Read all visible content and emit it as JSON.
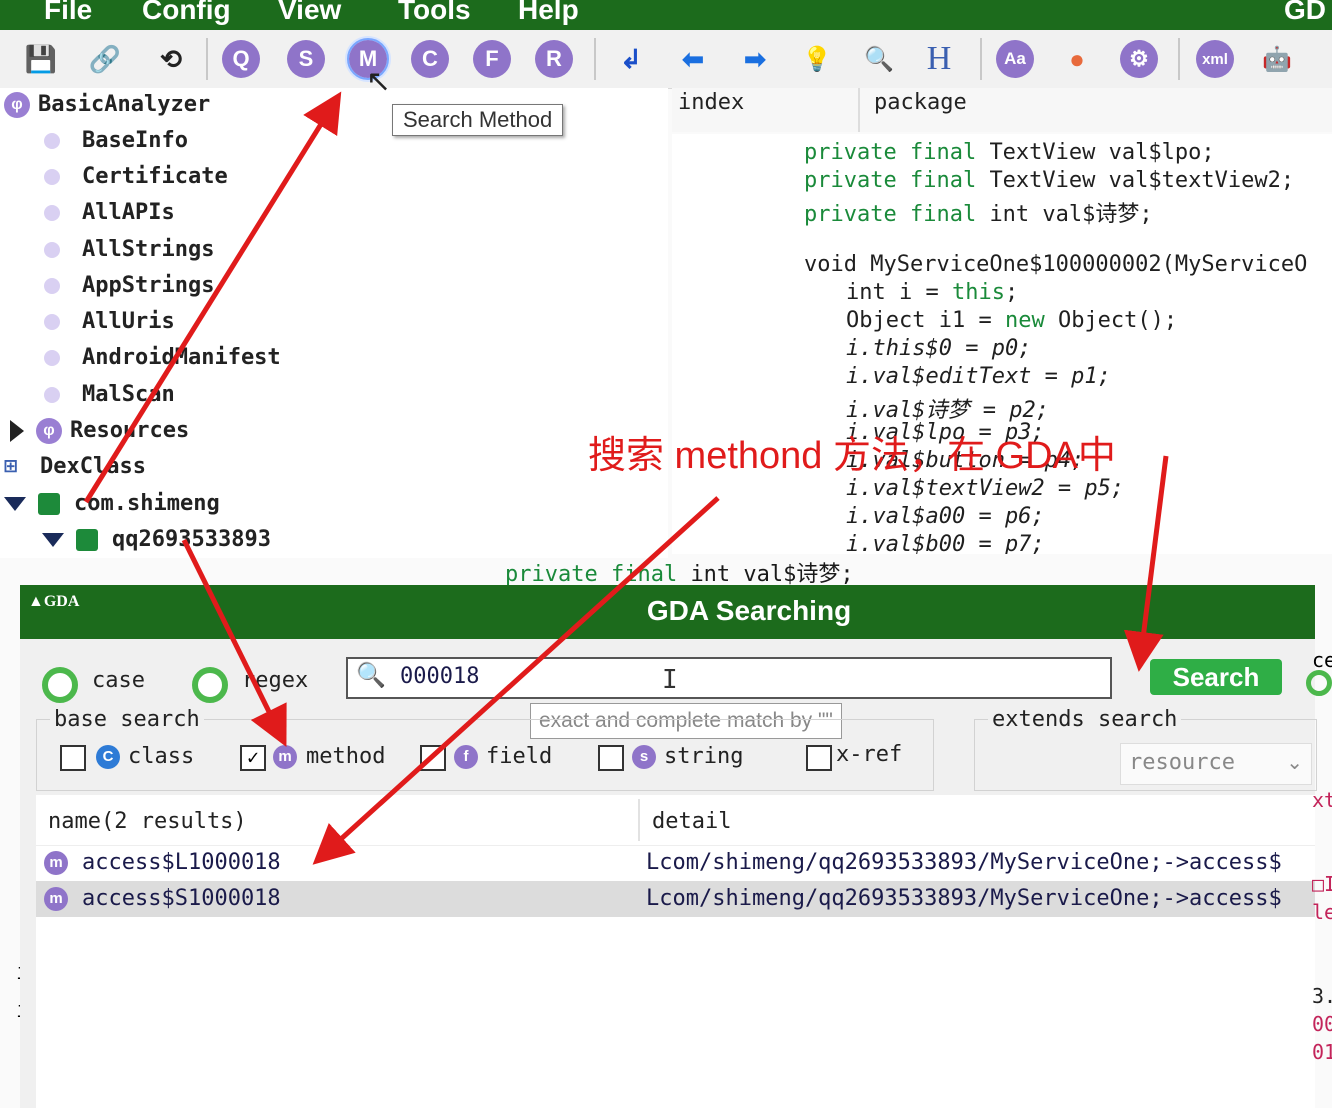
{
  "menubar": {
    "items": [
      "File",
      "Config",
      "View",
      "Tools",
      "Help"
    ],
    "app_label": "GD"
  },
  "toolbar": {
    "search_method_tooltip": "Search Method",
    "buttons": [
      {
        "name": "save-icon",
        "label": "💾"
      },
      {
        "name": "link-icon",
        "label": "🔗"
      },
      {
        "name": "user-refresh-icon",
        "label": "⟲"
      },
      {
        "name": "search-q-icon",
        "label": "Q"
      },
      {
        "name": "search-string-icon",
        "label": "S"
      },
      {
        "name": "search-method-icon",
        "label": "M"
      },
      {
        "name": "search-class-icon",
        "label": "C"
      },
      {
        "name": "search-field-icon",
        "label": "F"
      },
      {
        "name": "search-resource-icon",
        "label": "R"
      },
      {
        "name": "jump-icon",
        "label": "↲"
      },
      {
        "name": "back-icon",
        "label": "⬅"
      },
      {
        "name": "forward-icon",
        "label": "➡"
      },
      {
        "name": "bulb-icon",
        "label": "💡"
      },
      {
        "name": "report-icon",
        "label": "🔍"
      },
      {
        "name": "hex-icon",
        "label": "H"
      },
      {
        "name": "font-icon",
        "label": "Aa"
      },
      {
        "name": "palette-icon",
        "label": "●"
      },
      {
        "name": "settings-icon",
        "label": "⚙"
      },
      {
        "name": "xml-icon",
        "label": "xml"
      },
      {
        "name": "android-icon",
        "label": "🤖"
      }
    ]
  },
  "tree": {
    "root": "BasicAnalyzer",
    "children": [
      "BaseInfo",
      "Certificate",
      "AllAPIs",
      "AllStrings",
      "AppStrings",
      "AllUris",
      "AndroidManifest",
      "MalScan"
    ],
    "resources": "Resources",
    "dexclass": "DexClass",
    "package1": "com.shimeng",
    "package2": "qq2693533893"
  },
  "code_panel": {
    "col_index": "index",
    "col_package": "package",
    "lines": [
      "private final TextView val$lpo;",
      "private final TextView val$textView2;",
      "private final int val$诗梦;",
      "void MyServiceOne$100000002(MyServiceO",
      "int i = this;",
      "Object i1 = new Object();",
      "i.this$0 = p0;",
      "i.val$editText = p1;",
      "i.val$诗梦 = p2;",
      "i.val$lpo = p3;",
      "i.val$button = p4;",
      "i.val$textView2 = p5;",
      "i.val$a00 = p6;",
      "i.val$b00 = p7;"
    ],
    "overlap_line": "private final int val$诗梦;"
  },
  "annotation": "搜索 methond 方法，在 GDA中",
  "dialog": {
    "title": "GDA Searching",
    "option_case": "case",
    "option_regex": "regex",
    "search_value": "000018",
    "search_button": "Search",
    "input_hint": "exact and complete match by \"\"",
    "base_search_label": "base search",
    "cb_class": "class",
    "cb_method": "method",
    "cb_field": "field",
    "cb_string": "string",
    "cb_xref": "x-ref",
    "extends_search_label": "extends search",
    "extends_select": "resource",
    "results_header_name": "name(2 results)",
    "results_header_detail": "detail",
    "results": [
      {
        "name": "access$L1000018",
        "detail": "Lcom/shimeng/qq2693533893/MyServiceOne;->access$"
      },
      {
        "name": "access$S1000018",
        "detail": "Lcom/shimeng/qq2693533893/MyServiceOne;->access$"
      }
    ]
  },
  "right_edge": {
    "ce": "ce",
    "xt": "xt",
    "box": "□I",
    "le": "le",
    "n3": "3.",
    "n00": "00",
    "n01": "01"
  },
  "left_edge": {
    "i1": "i",
    "i2": "i"
  },
  "colors": {
    "brand_green": "#1c6b1c",
    "search_button": "#2fae46",
    "icon_purple": "#8f74c9",
    "annotation_red": "#e01b1b",
    "keyword_green": "#1a8a3a"
  }
}
